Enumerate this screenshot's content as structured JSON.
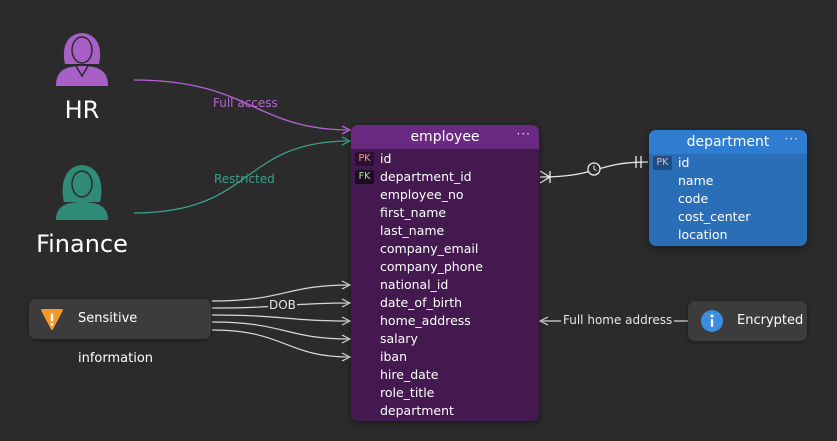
{
  "actors": [
    {
      "id": "hr",
      "label": "HR",
      "color": "#a960c6"
    },
    {
      "id": "finance",
      "label": "Finance",
      "color": "#2f8a78"
    }
  ],
  "edge_labels": {
    "full_access": "Full access",
    "restricted": "Restricted",
    "dob": "DOB",
    "full_home_address": "Full home address"
  },
  "edge_label_colors": {
    "full_access": "#b864d6",
    "restricted": "#3aa08a",
    "default": "#e6e6e6"
  },
  "tables": {
    "employee": {
      "title": "employee",
      "menu": "···",
      "fields": [
        {
          "key": "PK",
          "name": "id"
        },
        {
          "key": "FK",
          "name": "department_id"
        },
        {
          "key": "",
          "name": "employee_no"
        },
        {
          "key": "",
          "name": "first_name"
        },
        {
          "key": "",
          "name": "last_name"
        },
        {
          "key": "",
          "name": "company_email"
        },
        {
          "key": "",
          "name": "company_phone"
        },
        {
          "key": "",
          "name": "national_id"
        },
        {
          "key": "",
          "name": "date_of_birth"
        },
        {
          "key": "",
          "name": "home_address"
        },
        {
          "key": "",
          "name": "salary"
        },
        {
          "key": "",
          "name": "iban"
        },
        {
          "key": "",
          "name": "hire_date"
        },
        {
          "key": "",
          "name": "role_title"
        },
        {
          "key": "",
          "name": "department"
        }
      ]
    },
    "department": {
      "title": "department",
      "menu": "···",
      "fields": [
        {
          "key": "PK",
          "name": "id"
        },
        {
          "key": "",
          "name": "name"
        },
        {
          "key": "",
          "name": "code"
        },
        {
          "key": "",
          "name": "cost_center"
        },
        {
          "key": "",
          "name": "location"
        }
      ]
    }
  },
  "notes": {
    "sensitive": {
      "label": "Sensitive information",
      "icon": "warning-icon",
      "color": "#f39a2b"
    },
    "encrypted": {
      "label": "Encrypted",
      "icon": "info-icon",
      "color": "#3b8de0"
    }
  }
}
